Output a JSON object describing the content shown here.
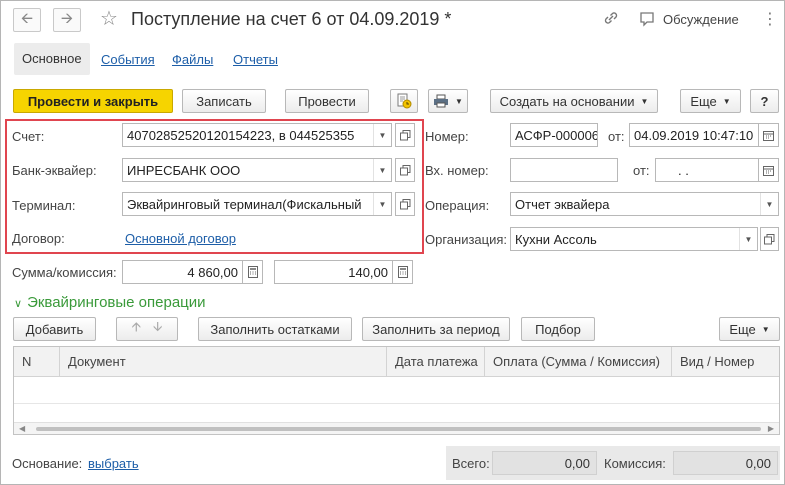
{
  "window": {
    "title": "Поступление на счет 6 от 04.09.2019 *",
    "discussion_label": "Обсуждение"
  },
  "tabs": [
    {
      "label": "Основное",
      "active": true
    },
    {
      "label": "События"
    },
    {
      "label": "Файлы"
    },
    {
      "label": "Отчеты"
    }
  ],
  "toolbar": {
    "post_and_close": "Провести и закрыть",
    "save": "Записать",
    "post": "Провести",
    "create_based_on": "Создать на основании",
    "more": "Еще",
    "help": "?"
  },
  "form": {
    "account_label": "Счет:",
    "account_value": "40702852520120154223, в 044525355",
    "acquirer_bank_label": "Банк-эквайер:",
    "acquirer_bank_value": "ИНРЕСБАНК ООО",
    "terminal_label": "Терминал:",
    "terminal_value": "Эквайринговый терминал(Фискальный",
    "contract_label": "Договор:",
    "contract_value": "Основной договор",
    "number_label": "Номер:",
    "number_value": "АСФР-000006",
    "from_label": "от:",
    "date_value": "04.09.2019 10:47:10",
    "incoming_number_label": "Вх. номер:",
    "incoming_number_value": "",
    "incoming_from_label": "от:",
    "incoming_date_value": " .  .",
    "operation_label": "Операция:",
    "operation_value": "Отчет эквайера",
    "organization_label": "Организация:",
    "organization_value": "Кухни Ассоль",
    "amount_label": "Сумма/комиссия:",
    "amount_value": "4 860,00",
    "commission_value": "140,00"
  },
  "operations": {
    "section_title": "Эквайринговые операции",
    "add": "Добавить",
    "fill_balances": "Заполнить остатками",
    "fill_period": "Заполнить за период",
    "selection": "Подбор",
    "more": "Еще",
    "columns": [
      "N",
      "Документ",
      "Дата платежа",
      "Оплата (Сумма / Комиссия)",
      "Вид / Номер"
    ]
  },
  "footer": {
    "basis_label": "Основание:",
    "basis_link": "выбрать",
    "total_label": "Всего:",
    "total_value": "0,00",
    "commission_label": "Комиссия:",
    "commission_value": "0,00"
  },
  "colors": {
    "primary_button": "#f6d400",
    "link": "#1d5ea8",
    "section_title": "#3a9a3a",
    "highlight_box": "#e0454f"
  }
}
